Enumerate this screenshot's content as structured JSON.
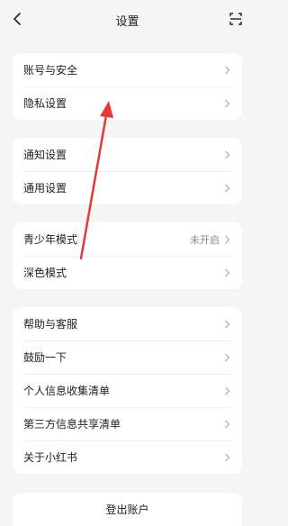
{
  "header": {
    "title": "设置",
    "back_icon": "chevron-left-icon",
    "scan_icon": "scan-icon"
  },
  "groups": [
    {
      "items": [
        {
          "label": "账号与安全"
        },
        {
          "label": "隐私设置"
        }
      ]
    },
    {
      "items": [
        {
          "label": "通知设置"
        },
        {
          "label": "通用设置"
        }
      ]
    },
    {
      "items": [
        {
          "label": "青少年模式",
          "value": "未开启"
        },
        {
          "label": "深色模式"
        }
      ]
    },
    {
      "items": [
        {
          "label": "帮助与客服"
        },
        {
          "label": "鼓励一下"
        },
        {
          "label": "个人信息收集清单"
        },
        {
          "label": "第三方信息共享清单"
        },
        {
          "label": "关于小红书"
        }
      ]
    }
  ],
  "logout_label": "登出账户",
  "colors": {
    "annotation_arrow": "#e53935",
    "chevron": "#b5b5b5"
  }
}
